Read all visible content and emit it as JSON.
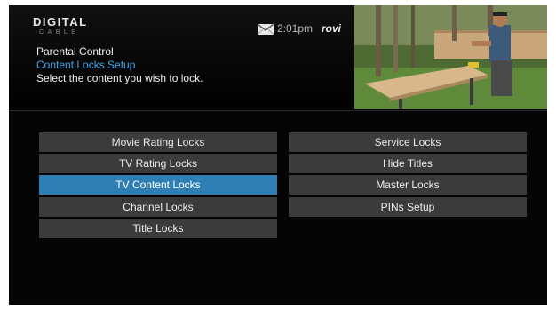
{
  "header": {
    "logo_main": "DIGITAL",
    "logo_sub": "CABLE",
    "time": "2:01pm",
    "brand": "rovi",
    "icons": {
      "mail": "envelope-icon"
    }
  },
  "menu": {
    "title": "Parental Control",
    "subtitle": "Content Locks Setup",
    "instruction": "Select the content you wish to lock."
  },
  "locks": {
    "left": [
      {
        "label": "Movie Rating Locks",
        "selected": false
      },
      {
        "label": "TV Rating Locks",
        "selected": false
      },
      {
        "label": "TV Content Locks",
        "selected": true
      },
      {
        "label": "Channel Locks",
        "selected": false
      },
      {
        "label": "Title Locks",
        "selected": false
      }
    ],
    "right": [
      {
        "label": "Service Locks",
        "selected": false
      },
      {
        "label": "Hide Titles",
        "selected": false
      },
      {
        "label": "Master Locks",
        "selected": false
      },
      {
        "label": "PINs Setup",
        "selected": false
      }
    ]
  },
  "colors": {
    "screen_bg": "#050505",
    "button_bg": "#3b3b3b",
    "selected_bg": "#2f7fb5",
    "subtitle_text": "#3fa6ea"
  }
}
